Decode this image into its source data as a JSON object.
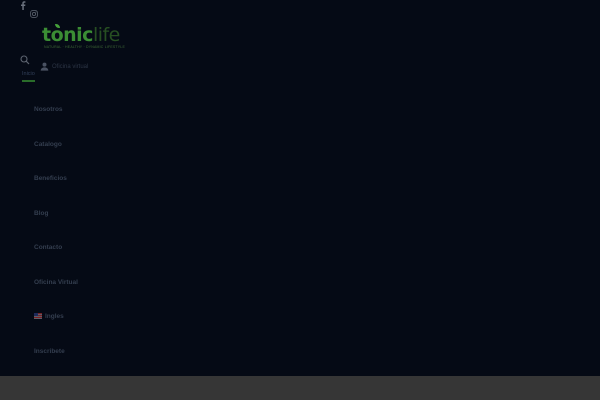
{
  "social": {
    "facebook_icon": "facebook-icon",
    "instagram_icon": "instagram-icon"
  },
  "logo": {
    "part1": "tonic",
    "part2": "life",
    "tagline": "NATURAL · HEALTHY · DYNAMIC LIFESTYLE"
  },
  "header": {
    "search_icon": "search-icon",
    "office_label": "Oficina virtual",
    "inicio_label": "Inicio"
  },
  "menu": {
    "items": [
      {
        "label": "Nosotros"
      },
      {
        "label": "Catalogo"
      },
      {
        "label": "Beneficios"
      },
      {
        "label": "Blog"
      },
      {
        "label": "Contacto"
      },
      {
        "label": "Oficina Virtual"
      },
      {
        "label": "Ingles",
        "icon": "us-flag-icon"
      },
      {
        "label": "Inscribete"
      }
    ]
  },
  "colors": {
    "background": "#050a15",
    "accent_green": "#2a6d2a",
    "footer": "#363636"
  }
}
